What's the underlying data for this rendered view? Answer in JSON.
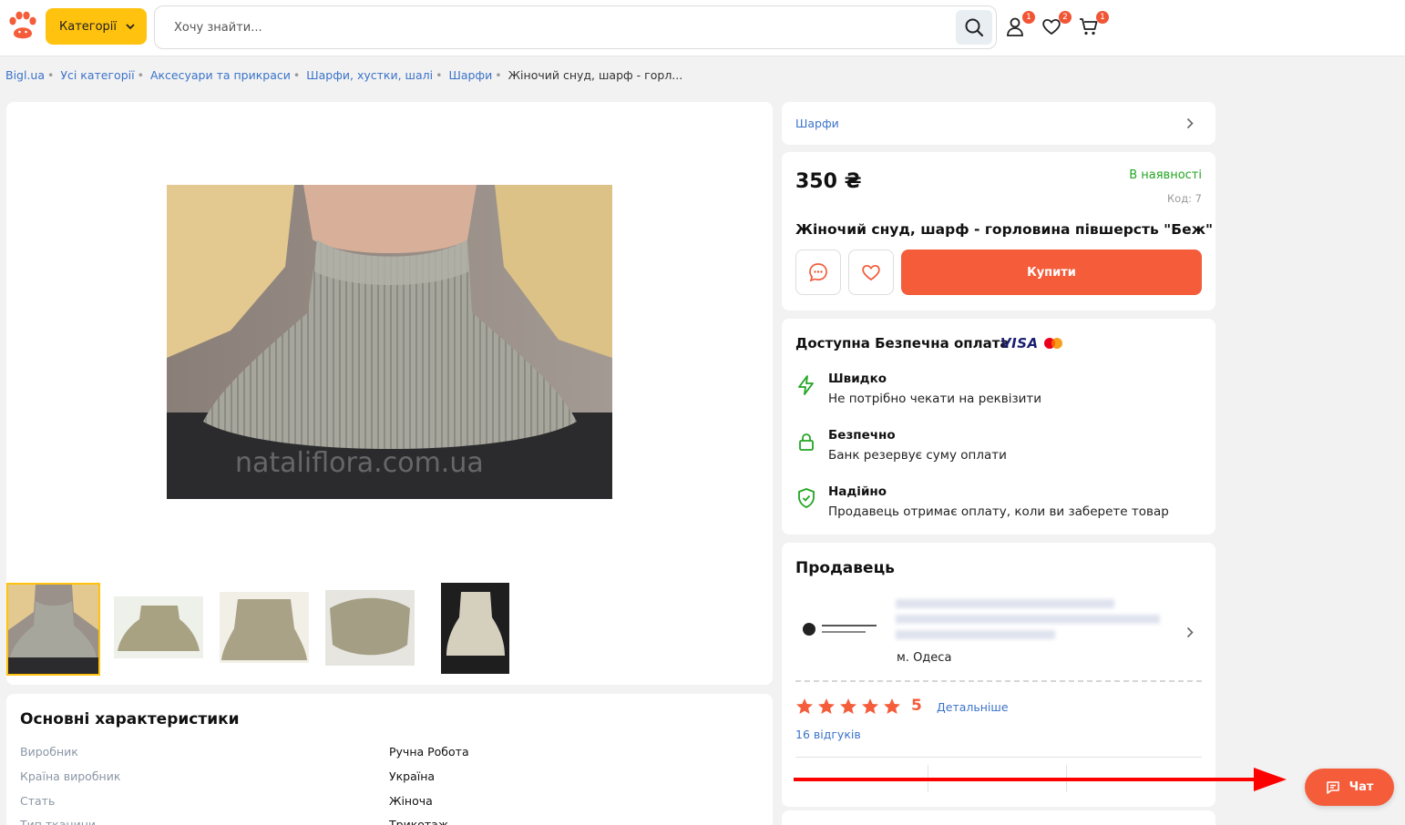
{
  "header": {
    "categories_label": "Категорії",
    "search_placeholder": "Хочу знайти...",
    "badges": {
      "profile": "1",
      "favorites": "2",
      "cart": "1"
    }
  },
  "breadcrumbs": [
    "Bigl.ua",
    "Усі категорії",
    "Аксесуари та прикраси",
    "Шарфи, хустки, шалі",
    "Шарфи"
  ],
  "breadcrumb_current": "Жіночий снуд, шарф - горл...",
  "product": {
    "category_link": "Шарфи",
    "price": "350 ₴",
    "availability": "В наявності",
    "code": "Код: 7",
    "title": "Жіночий снуд, шарф - горловина півшерсть \"Беж\"",
    "buy_label": "Купити",
    "image_watermark": "nataliflora.com.ua"
  },
  "payment": {
    "title": "Доступна Безпечна оплата",
    "visa_label": "VISA",
    "features": [
      {
        "title": "Швидко",
        "desc": "Не потрібно чекати на реквізити",
        "icon": "lightning-icon"
      },
      {
        "title": "Безпечно",
        "desc": "Банк резервує суму оплати",
        "icon": "lock-icon"
      },
      {
        "title": "Надійно",
        "desc": "Продавець отримає оплату, коли ви заберете товар",
        "icon": "shield-check-icon"
      }
    ]
  },
  "seller": {
    "title": "Продавець",
    "city": "м. Одеса",
    "rating": "5",
    "rating_stars": 5,
    "details_link": "Детальніше",
    "reviews": "16 відгуків"
  },
  "specs": {
    "title": "Основні характеристики",
    "rows": [
      {
        "k": "Виробник",
        "v": "Ручна Робота"
      },
      {
        "k": "Країна виробник",
        "v": "Україна"
      },
      {
        "k": "Стать",
        "v": "Жіноча"
      },
      {
        "k": "Тип тканини",
        "v": "Трикотаж"
      }
    ]
  },
  "chat": {
    "label": "Чат"
  },
  "colors": {
    "accent": "#f45c3a",
    "yellow": "#ffc20e",
    "link": "#3b73c9",
    "green": "#22a522"
  }
}
